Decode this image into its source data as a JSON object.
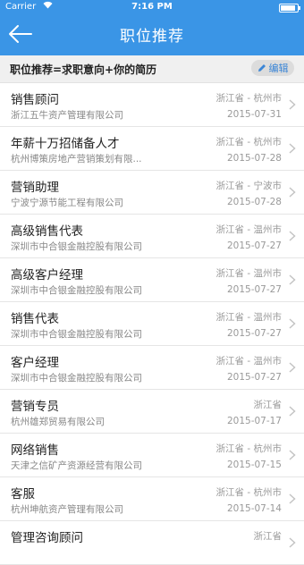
{
  "status_bar": {
    "carrier": "Carrier",
    "time": "7:16 PM"
  },
  "nav": {
    "title": "职位推荐"
  },
  "subheader": {
    "formula": "职位推荐=求职意向+你的简历",
    "edit_label": "编辑"
  },
  "jobs": [
    {
      "title": "销售顾问",
      "company": "浙江五牛资产管理有限公司",
      "location": "浙江省 - 杭州市",
      "date": "2015-07-31"
    },
    {
      "title": "年薪十万招储备人才",
      "company": "杭州博策房地产营销策划有限...",
      "location": "浙江省 - 杭州市",
      "date": "2015-07-28"
    },
    {
      "title": "营销助理",
      "company": "宁波宁源节能工程有限公司",
      "location": "浙江省 - 宁波市",
      "date": "2015-07-28"
    },
    {
      "title": "高级销售代表",
      "company": "深圳市中合银金融控股有限公司",
      "location": "浙江省 - 温州市",
      "date": "2015-07-27"
    },
    {
      "title": "高级客户经理",
      "company": "深圳市中合银金融控股有限公司",
      "location": "浙江省 - 温州市",
      "date": "2015-07-27"
    },
    {
      "title": "销售代表",
      "company": "深圳市中合银金融控股有限公司",
      "location": "浙江省 - 温州市",
      "date": "2015-07-27"
    },
    {
      "title": "客户经理",
      "company": "深圳市中合银金融控股有限公司",
      "location": "浙江省 - 温州市",
      "date": "2015-07-27"
    },
    {
      "title": "营销专员",
      "company": "杭州雄郑贸易有限公司",
      "location": "浙江省",
      "date": "2015-07-17"
    },
    {
      "title": "网络销售",
      "company": "天津之信矿产资源经营有限公司",
      "location": "浙江省 - 杭州市",
      "date": "2015-07-15"
    },
    {
      "title": "客服",
      "company": "杭州坤航资产管理有限公司",
      "location": "浙江省 - 杭州市",
      "date": "2015-07-14"
    },
    {
      "title": "管理咨询顾问",
      "company": "",
      "location": "浙江省",
      "date": ""
    }
  ]
}
